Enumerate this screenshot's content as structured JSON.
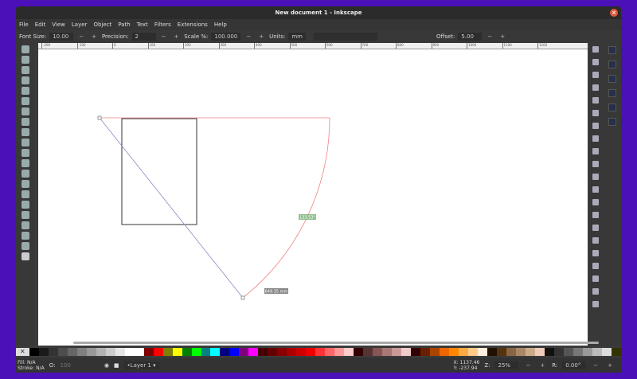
{
  "window": {
    "title": "New document 1 - Inkscape"
  },
  "menu": [
    "File",
    "Edit",
    "View",
    "Layer",
    "Object",
    "Path",
    "Text",
    "Filters",
    "Extensions",
    "Help"
  ],
  "toolbar": {
    "font_size_label": "Font Size:",
    "font_size": "10.00",
    "precision_label": "Precision:",
    "precision": "2",
    "scale_label": "Scale %:",
    "scale": "100.000",
    "units_label": "Units:",
    "units": "mm",
    "offset_label": "Offset:",
    "offset": "5.00",
    "minus": "−",
    "plus": "+"
  },
  "ruler": [
    "-200",
    "-100",
    "0",
    "100",
    "200",
    "300",
    "400",
    "500",
    "600",
    "700",
    "800",
    "900",
    "1000",
    "1100",
    "1200"
  ],
  "canvas": {
    "angle_label": "133.53°",
    "length_label": "649.35 mm",
    "measure_color": "#f08080"
  },
  "palette": [
    "#000",
    "#1a1a1a",
    "#333",
    "#4d4d4d",
    "#666",
    "#808080",
    "#999",
    "#b3b3b3",
    "#ccc",
    "#e6e6e6",
    "#fff",
    "#fff",
    "#800000",
    "#f00",
    "#808000",
    "#ff0",
    "#008000",
    "#0f0",
    "#008080",
    "#0ff",
    "#000080",
    "#00f",
    "#800080",
    "#f0f",
    "#400",
    "#600",
    "#800",
    "#a00",
    "#c00",
    "#e00",
    "#f33",
    "#f66",
    "#f99",
    "#fcc",
    "#300",
    "#533",
    "#855",
    "#a77",
    "#c99",
    "#ecc",
    "#300",
    "#620",
    "#a40",
    "#e60",
    "#f80",
    "#fa4",
    "#fc8",
    "#fed",
    "#210",
    "#531",
    "#864",
    "#a86",
    "#ca8",
    "#ecb",
    "#111",
    "#333",
    "#555",
    "#777",
    "#999",
    "#bbb",
    "#ddd",
    "#330"
  ],
  "status": {
    "fill_label": "Fill:",
    "fill": "N/A",
    "stroke_label": "Stroke:",
    "stroke": "N/A",
    "opacity_label": "O:",
    "opacity": "100",
    "layer": "•Layer 1 ▾",
    "x_label": "X:",
    "x": "1137.46",
    "y_label": "Y:",
    "y": "-237.94",
    "zoom_label": "Z:",
    "zoom": "25%",
    "rotate_label": "R:",
    "rotate": "0.00°"
  }
}
